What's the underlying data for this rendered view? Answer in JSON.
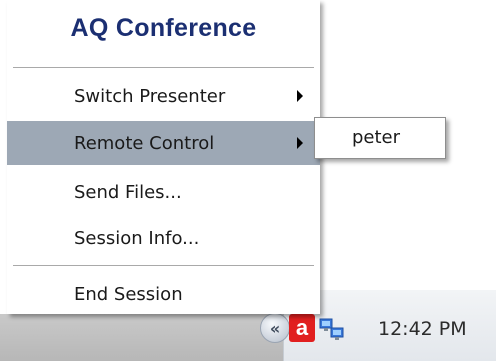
{
  "menu": {
    "title": "AQ Conference",
    "items": [
      {
        "label": "Switch Presenter",
        "has_submenu": true
      },
      {
        "label": "Remote Control",
        "has_submenu": true,
        "highlighted": true
      },
      {
        "label": "Send Files..."
      },
      {
        "label": "Session Info..."
      },
      {
        "label": "End Session"
      }
    ]
  },
  "submenu": {
    "items": [
      {
        "label": "peter"
      }
    ]
  },
  "taskbar": {
    "tray_icons": [
      "chevron-left-icon",
      "app-a-icon",
      "network-icon"
    ],
    "app_icon_letter": "a",
    "clock": "12:42 PM"
  },
  "colors": {
    "menu_title": "#1b2f72",
    "highlight": "#9da8b5",
    "app_icon": "#e11f1f"
  }
}
